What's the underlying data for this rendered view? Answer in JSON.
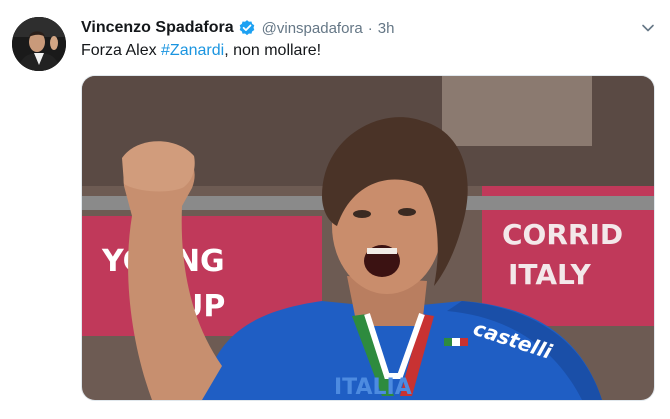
{
  "tweet": {
    "author": {
      "display_name": "Vincenzo Spadafora",
      "verified": true,
      "handle": "@vinspadafora",
      "separator": "·",
      "time": "3h"
    },
    "text_prefix": "Forza Alex ",
    "hashtag": "#Zanardi",
    "text_suffix": ", non mollare!",
    "media": {
      "banner_left_line1": "YCLING",
      "banner_left_line2": "CUP",
      "banner_right_line1": "CORRID",
      "banner_right_line2": "ITALY",
      "jersey_brand": "castelli",
      "jersey_text": "ITALIA"
    }
  },
  "colors": {
    "link": "#1b95e0",
    "verified": "#1da1f2",
    "jersey": "#1f5ec4",
    "banner": "#c0395a"
  }
}
